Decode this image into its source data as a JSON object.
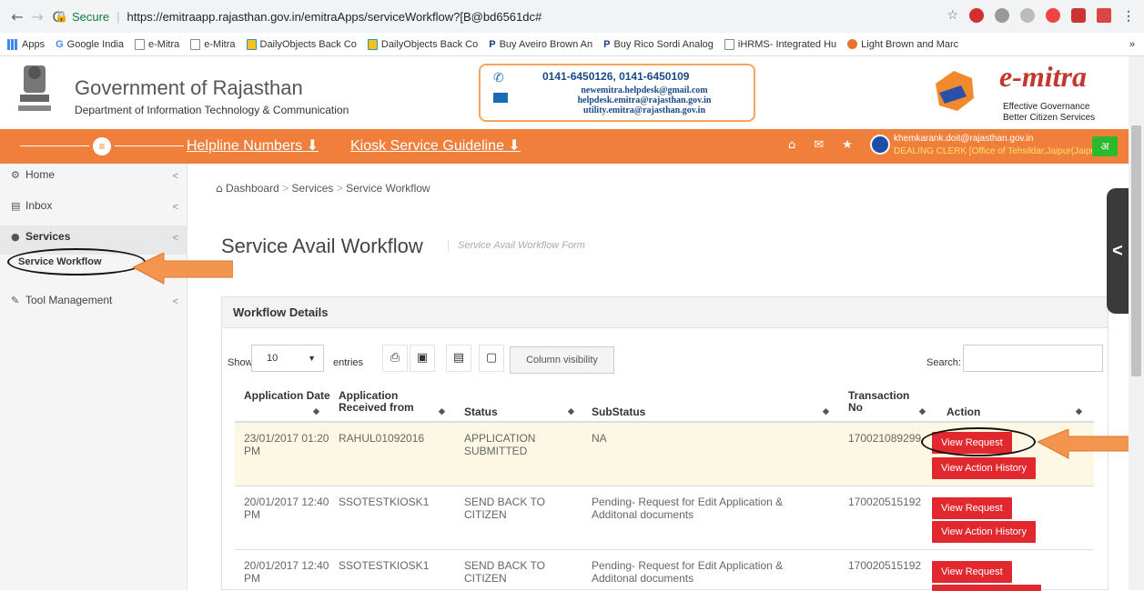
{
  "browser": {
    "back_icon": "←",
    "forward_icon": "→",
    "reload_icon": "C",
    "secure_label": "Secure",
    "url": "https://emitraapp.rajasthan.gov.in/emitraApps/serviceWorkflow?[B@bd6561dc#"
  },
  "bookmarks": [
    {
      "label": "Apps"
    },
    {
      "label": "Google India"
    },
    {
      "label": "e-Mitra"
    },
    {
      "label": "e-Mitra"
    },
    {
      "label": "DailyObjects Back Co"
    },
    {
      "label": "DailyObjects Back Co"
    },
    {
      "label": "Buy Aveiro Brown An"
    },
    {
      "label": "Buy Rico Sordi Analog"
    },
    {
      "label": "iHRMS- Integrated Hu"
    },
    {
      "label": "Light Brown and Marc"
    },
    {
      "label": "»"
    }
  ],
  "header": {
    "gov_title": "Government of Rajasthan",
    "dept_title": "Department of Information Technology & Communication",
    "phones": "0141-6450126, 0141-6450109",
    "emails": [
      "newemitra.helpdesk@gmail.com",
      "helpdesk.emitra@rajasthan.gov.in",
      "utility.emitra@rajasthan.gov.in"
    ],
    "brand": "e-mitra",
    "tagline1": "Effective Governance",
    "tagline2": "Better Citizen Services"
  },
  "topbar": {
    "helpline": "Helpline Numbers",
    "kiosk": "Kiosk Service Guideline",
    "user_email": "khemkarank.doit@rajasthan.gov.in",
    "user_role": "DEALING CLERK [Office of Tehsildar,Jaipur(Jaipur)]",
    "lang": "अ"
  },
  "sidebar": {
    "items": [
      {
        "label": "Home"
      },
      {
        "label": "Inbox"
      },
      {
        "label": "Services"
      },
      {
        "label": "Tool Management"
      }
    ],
    "sub_item": "Service Workflow"
  },
  "breadcrumb": {
    "home": "Dashboard",
    "sep1": ">",
    "services": "Services",
    "sep2": ">",
    "current": "Service Workflow"
  },
  "page": {
    "title": "Service Avail Workflow",
    "subtitle": "Service Avail Workflow Form"
  },
  "panel": {
    "heading": "Workflow Details",
    "show_label": "Show",
    "page_size": "10",
    "entries_label": "entries",
    "colvis_label": "Column visibility",
    "search_label": "Search:",
    "columns": [
      "Application Date",
      "Application Received from",
      "Status",
      "SubStatus",
      "Transaction No",
      "Action"
    ],
    "rows": [
      {
        "date": "23/01/2017 01:20 PM",
        "from": "RAHUL01092016",
        "status": "APPLICATION SUBMITTED",
        "substatus": "NA",
        "txn": "170021089299",
        "btn1": "View Request",
        "btn2": "View Action History"
      },
      {
        "date": "20/01/2017 12:40 PM",
        "from": "SSOTESTKIOSK1",
        "status": "SEND BACK TO CITIZEN",
        "substatus": "Pending- Request for Edit Application & Additonal documents",
        "txn": "170020515192",
        "btn1": "View Request",
        "btn2": "View Action History"
      },
      {
        "date": "20/01/2017 12:40 PM",
        "from": "SSOTESTKIOSK1",
        "status": "SEND BACK TO CITIZEN",
        "substatus": "Pending- Request for Edit Application & Additonal documents",
        "txn": "170020515192",
        "btn1": "View Request",
        "btn2": ""
      }
    ]
  },
  "colors": {
    "orange": "#f07f3c",
    "red_button": "#e0282e",
    "highlight_row": "#fcf8e3"
  }
}
